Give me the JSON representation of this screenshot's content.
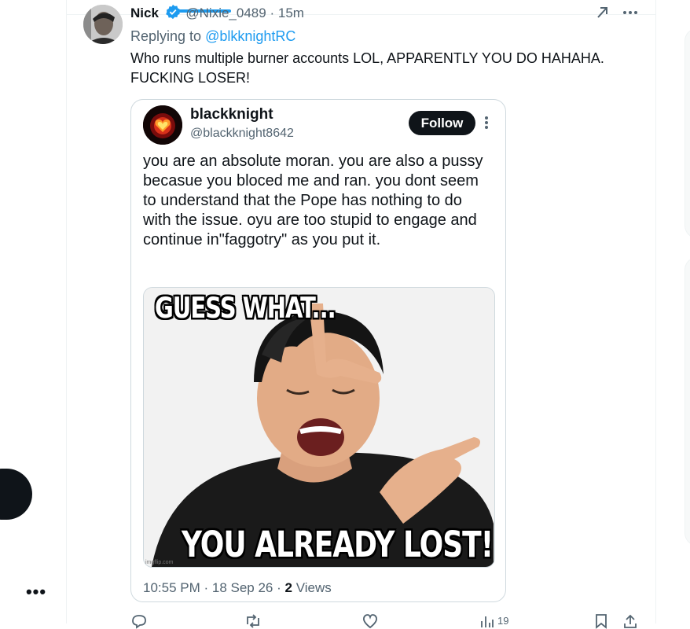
{
  "tweet": {
    "author_name": "Nick",
    "author_handle": "@Nixie_0489",
    "separator": "·",
    "time_ago": "15m",
    "replying_prefix": "Replying to ",
    "replying_handle": "@blkknightRC",
    "text": "Who runs multiple burner accounts LOL, APPARENTLY YOU DO HAHAHA. FUCKING LOSER!"
  },
  "quoted": {
    "name": "blackknight",
    "handle": "@blackknight8642",
    "follow_label": "Follow",
    "text": "you are an absolute moran. you are also a pussy becasue you bloced me and ran. you dont seem to understand that the Pope has nothing to do with the issue.  oyu are too stupid to engage and continue in\"faggotry\" as you put it.",
    "meme_top": "GUESS WHAT...",
    "meme_bottom": "YOU ALREADY LOST!",
    "meme_watermark": "imgflip.com",
    "timestamp": "10:55 PM · 18 Sep 26 · ",
    "views_count": "2",
    "views_label": " Views"
  },
  "actions": {
    "views": "19"
  },
  "colors": {
    "accent": "#1d9bf0",
    "text": "#0f1419",
    "secondary": "#536471",
    "border": "#cfd9de"
  },
  "icons": [
    "verified-badge-icon",
    "grok-icon",
    "more-icon",
    "reply-icon",
    "retweet-icon",
    "like-icon",
    "views-icon",
    "bookmark-icon",
    "share-icon"
  ]
}
